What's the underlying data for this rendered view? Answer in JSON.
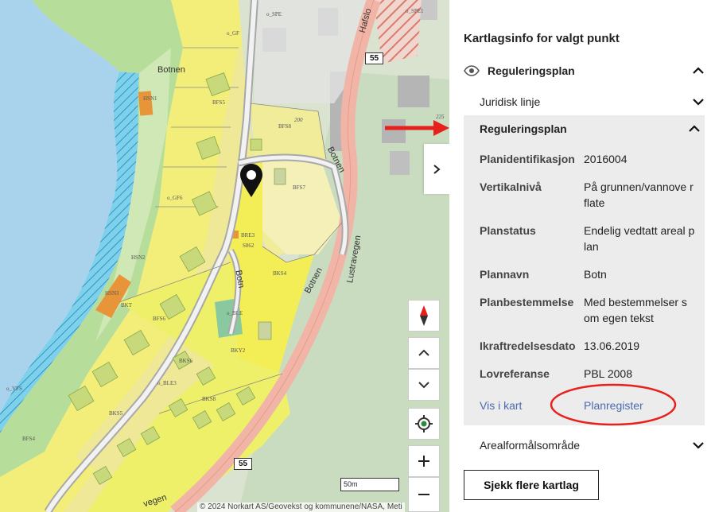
{
  "map": {
    "road_labels": [
      "55",
      "55"
    ],
    "place_labels": [
      "Botnen",
      "Botn",
      "Botnen",
      "Lustravegen",
      "Lustravegen",
      "Hafslo",
      "vegen"
    ],
    "zone_labels": [
      "BFS8",
      "BFS7",
      "BRE3",
      "BKS4",
      "BKS6",
      "BKS8",
      "BKS5",
      "o_BLE3",
      "o_BLE",
      "BFS6",
      "HSN1",
      "HSN2",
      "HSN3",
      "o_GF6",
      "o_GF",
      "o_SPE",
      "BKT",
      "o_SPE1",
      "BFS4",
      "BFS5",
      "200",
      "225",
      "BKY2",
      "S862",
      "o_VFS"
    ],
    "scale_label": "50m",
    "attribution": "© 2024 Norkart AS/Geovekst og kommunene/NASA, Meti"
  },
  "panel": {
    "title": "Kartlagsinfo for valgt punkt",
    "layer_name": "Reguleringsplan",
    "sub_juridisk": "Juridisk linje",
    "sub_regplan": "Reguleringsplan",
    "attributes": [
      {
        "key": "Planidentifikasjon",
        "value": "2016004"
      },
      {
        "key": "Vertikalnivå",
        "value": "På grunnen/vannove rflate"
      },
      {
        "key": "Planstatus",
        "value": "Endelig vedtatt areal plan"
      },
      {
        "key": "Plannavn",
        "value": "Botn"
      },
      {
        "key": "Planbestemmelse",
        "value": "Med bestemmelser s om egen tekst"
      },
      {
        "key": "Ikraftredelsesdato",
        "value": "13.06.2019"
      },
      {
        "key": "Lovreferanse",
        "value": "PBL 2008"
      }
    ],
    "link_map": "Vis i kart",
    "link_register": "Planregister",
    "sub_areal": "Arealformålsområde",
    "more_button": "Sjekk flere kartlag"
  },
  "colors": {
    "link": "#4a6bb0",
    "annotation_red": "#e8201c",
    "yellow_zone": "#f3ee7a",
    "water": "#a9d3ec"
  }
}
